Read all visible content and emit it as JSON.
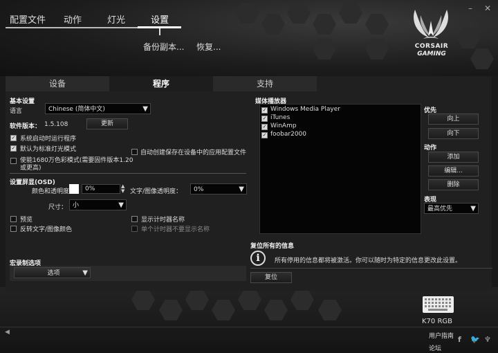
{
  "nav": {
    "tabs": [
      "配置文件",
      "动作",
      "灯光",
      "设置"
    ],
    "active_index": 3,
    "sub": [
      "备份副本...",
      "恢复..."
    ]
  },
  "window": {
    "minimize": "–",
    "close": "✕"
  },
  "brand": {
    "line1": "CORSAIR",
    "line2": "GAMING"
  },
  "panel_tabs": [
    "设备",
    "程序",
    "支持"
  ],
  "panel_active": 1,
  "basic": {
    "title": "基本设置",
    "language_label": "语言",
    "language_value": "Chinese (简体中文)",
    "version_label": "软件版本：",
    "version_value": "1.5.108",
    "update_button": "更新",
    "options": [
      {
        "label": "系统启动时运行程序",
        "checked": true
      },
      {
        "label": "默认为标准灯光模式",
        "checked": true
      },
      {
        "label": "使能1680万色彩模式(需要固件版本1.20",
        "checked": false
      },
      {
        "label": "或更高)",
        "checked": false
      }
    ],
    "auto_save_label": "自动创建保存在设备中的应用配置文件"
  },
  "osd": {
    "title": "设置屏显(OSD)",
    "color_label": "颜色和透明度",
    "color_value": "0%",
    "text_opacity_label": "文字/图像透明度：",
    "text_opacity_value": "0%",
    "size_label": "尺寸：",
    "size_value": "小",
    "preview_label": "预览",
    "invert_label": "反转文字/图像颜色",
    "show_timer_label": "显示计时器名称",
    "single_timer_label": "单个计时器不要显示名称"
  },
  "macro": {
    "title": "宏录制选项",
    "button": "选项"
  },
  "media": {
    "title": "媒体播放器",
    "players": [
      {
        "name": "Windows Media Player",
        "checked": true
      },
      {
        "name": "iTunes",
        "checked": true
      },
      {
        "name": "WinAmp",
        "checked": true
      },
      {
        "name": "foobar2000",
        "checked": true
      }
    ],
    "priority_title": "优先",
    "up_button": "向上",
    "down_button": "向下",
    "action_title": "动作",
    "add_button": "添加",
    "edit_button": "编辑...",
    "delete_button": "删除",
    "perf_title": "表现",
    "perf_value": "最高优先"
  },
  "reset": {
    "title": "复位所有的信息",
    "info": "所有停用的信息都将被激活。你可以随时为特定的信息更改此设置。",
    "button": "复位"
  },
  "footer": {
    "device": "K70 RGB",
    "scan_label": "用户指南",
    "forum_label": "论坛",
    "scroll_arrow": "◀"
  }
}
